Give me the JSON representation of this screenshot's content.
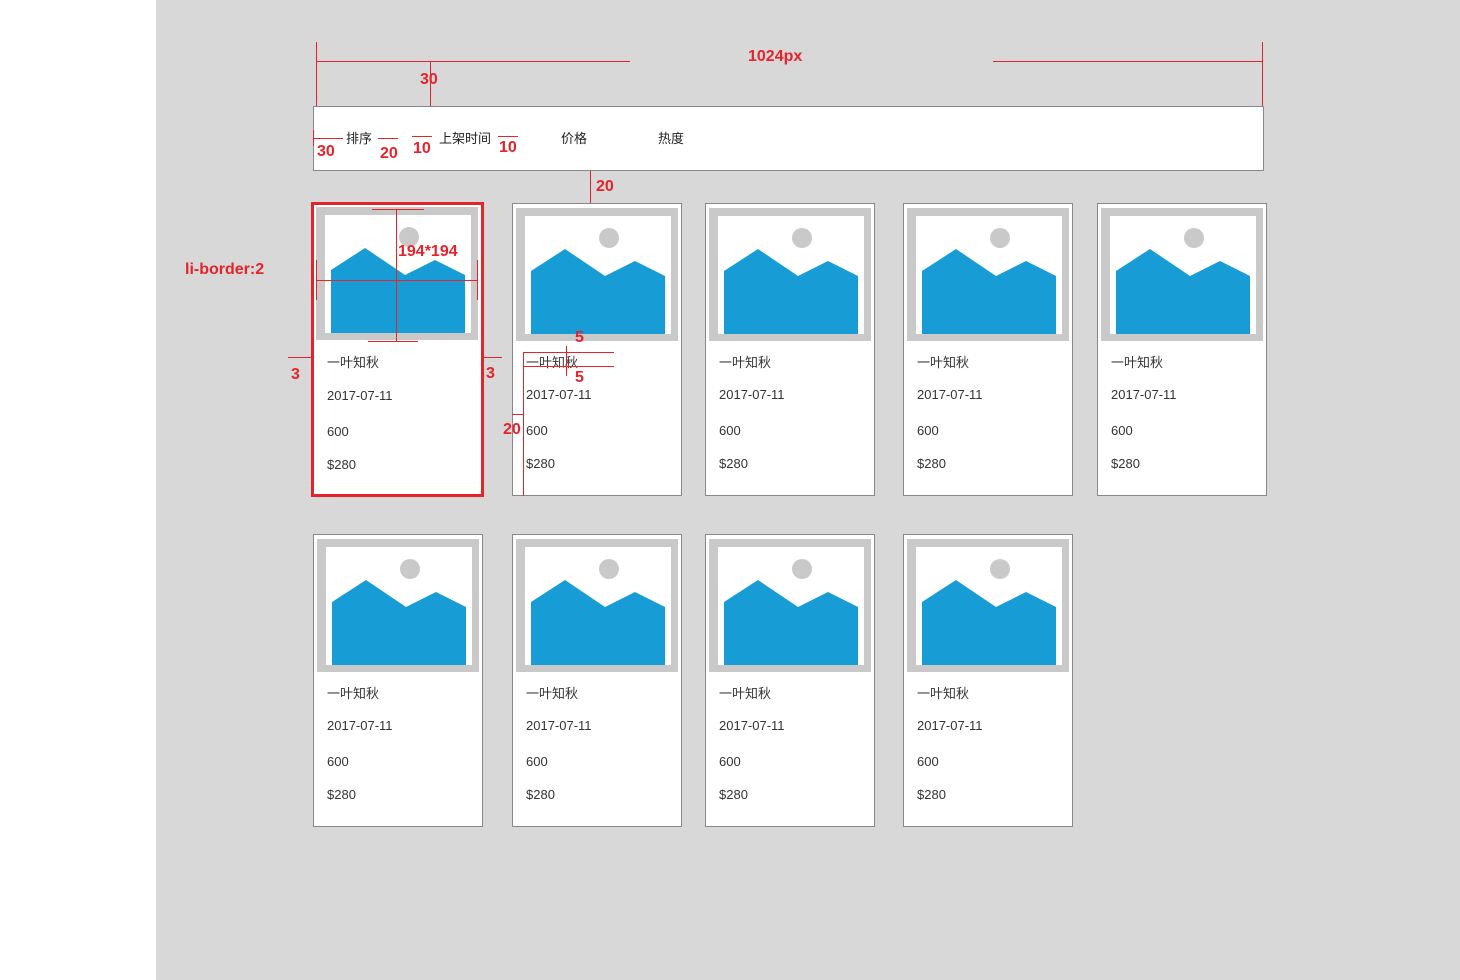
{
  "spec": {
    "width_label": "1024px",
    "top_gap_label": "30",
    "sort_left_label": "30",
    "sort_gap_label": "20",
    "item_gap_left_label": "10",
    "item_gap_right_label": "10",
    "toolbar_gap_label": "20",
    "image_size_label": "194*194",
    "li_border_label": "li-border:2",
    "li_margin_left_label": "3",
    "li_margin_right_label": "3",
    "text_gap_top_label": "5",
    "text_gap_bottom_label": "5",
    "text_indent_label": "20"
  },
  "sort_bar": {
    "title": "排序",
    "items": [
      "上架时间",
      "价格",
      "热度"
    ]
  },
  "products": [
    {
      "name": "一叶知秋",
      "date": "2017-07-11",
      "count": "600",
      "price": "$280"
    },
    {
      "name": "一叶知秋",
      "date": "2017-07-11",
      "count": "600",
      "price": "$280"
    },
    {
      "name": "一叶知秋",
      "date": "2017-07-11",
      "count": "600",
      "price": "$280"
    },
    {
      "name": "一叶知秋",
      "date": "2017-07-11",
      "count": "600",
      "price": "$280"
    },
    {
      "name": "一叶知秋",
      "date": "2017-07-11",
      "count": "600",
      "price": "$280"
    },
    {
      "name": "一叶知秋",
      "date": "2017-07-11",
      "count": "600",
      "price": "$280"
    },
    {
      "name": "一叶知秋",
      "date": "2017-07-11",
      "count": "600",
      "price": "$280"
    },
    {
      "name": "一叶知秋",
      "date": "2017-07-11",
      "count": "600",
      "price": "$280"
    },
    {
      "name": "一叶知秋",
      "date": "2017-07-11",
      "count": "600",
      "price": "$280"
    }
  ],
  "colors": {
    "annotation": "#e5232b",
    "image_mountain": "#189cd5",
    "image_frame": "#c9c9c9",
    "canvas": "#d8d8d8"
  }
}
